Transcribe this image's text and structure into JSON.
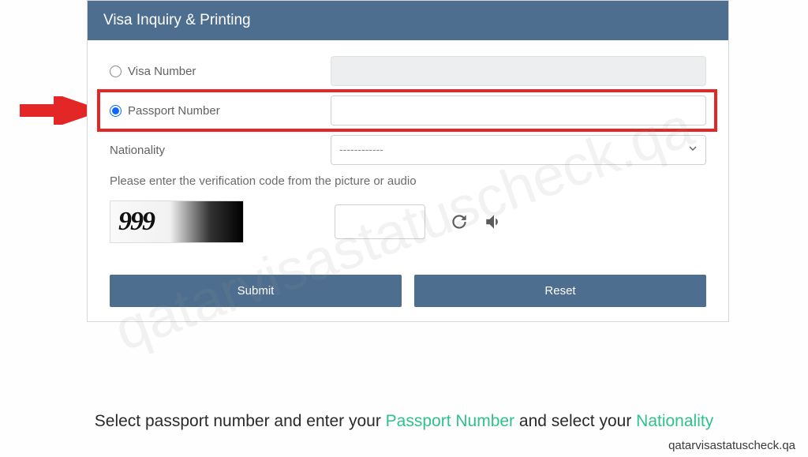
{
  "panel": {
    "title": "Visa Inquiry & Printing"
  },
  "form": {
    "visa_number_label": "Visa Number",
    "passport_number_label": "Passport Number",
    "nationality_label": "Nationality",
    "nationality_placeholder": "------------",
    "verification_text": "Please enter the verification code from the picture or audio",
    "captcha_value": "999"
  },
  "buttons": {
    "submit": "Submit",
    "reset": "Reset"
  },
  "caption": {
    "part1": "Select passport number and enter your ",
    "highlight1": "Passport Number",
    "part2": " and select your ",
    "highlight2": "Nationality"
  },
  "footer": "qatarvisastatuscheck.qa",
  "watermark": "qatarvisastatuscheck.qa"
}
